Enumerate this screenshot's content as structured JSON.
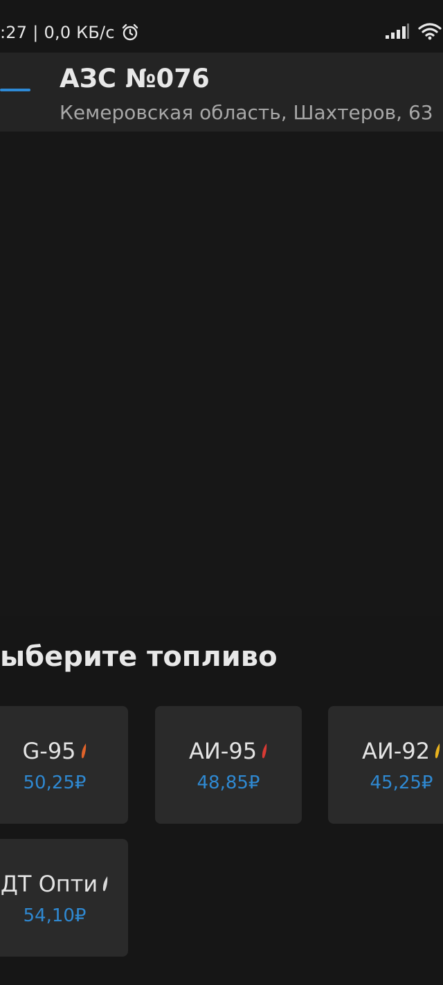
{
  "status_bar": {
    "time": ":27",
    "separator": "|",
    "net_speed": "0,0 КБ/с",
    "icons": [
      "alarm-icon",
      "signal-icon",
      "wifi-icon"
    ]
  },
  "header": {
    "title": "АЗС №076",
    "address": "Кемеровская область, Шахтеров, 63"
  },
  "fuel_section": {
    "title": "ыберите топливо",
    "items": [
      {
        "name": "G-95",
        "price": "50,25₽",
        "drop_color": "#e0632a"
      },
      {
        "name": "АИ-95",
        "price": "48,85₽",
        "drop_color": "#d83a34"
      },
      {
        "name": "АИ-92",
        "price": "45,25₽",
        "drop_color": "#e8b21e"
      },
      {
        "name": "ДТ Опти",
        "price": "54,10₽",
        "drop_color": "#d8d8d8"
      }
    ]
  },
  "colors": {
    "background": "#161616",
    "header_bg": "#242424",
    "card_bg": "#2a2a2a",
    "accent": "#2f89d2"
  }
}
